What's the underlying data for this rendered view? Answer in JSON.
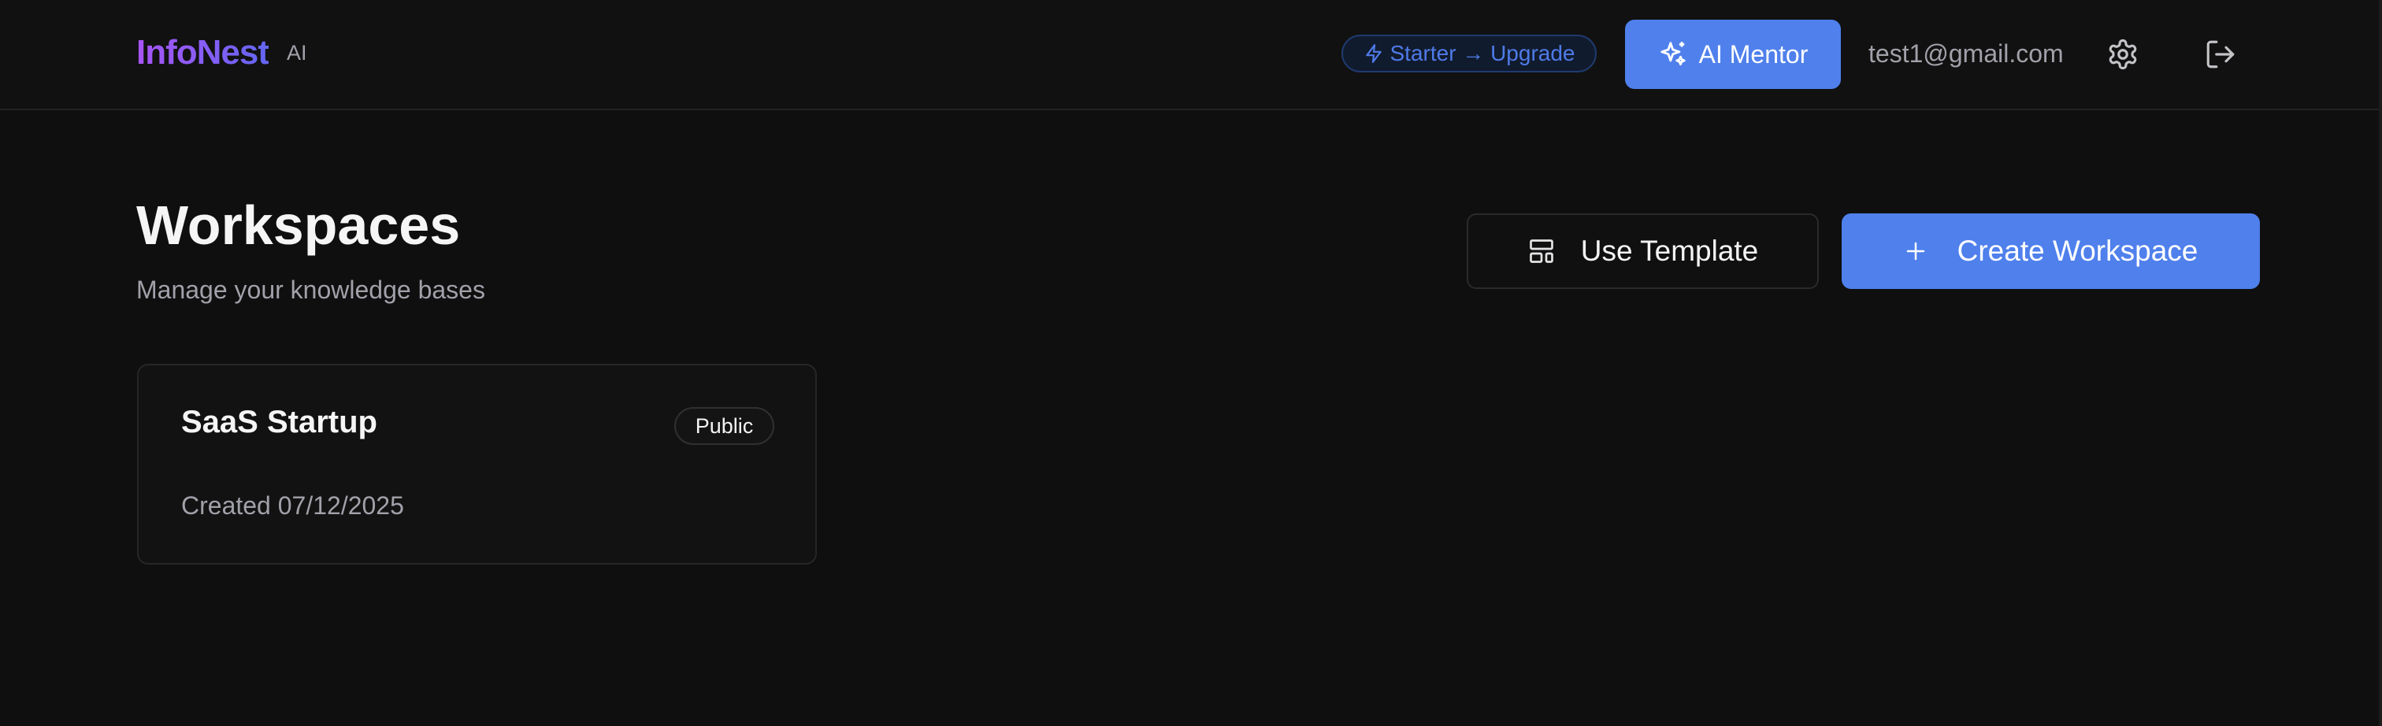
{
  "header": {
    "logo_text": "InfoNest",
    "logo_suffix": "AI",
    "plan_label": "Starter → Upgrade",
    "mentor_label": "AI Mentor",
    "user_email": "test1@gmail.com",
    "icons": {
      "plan": "bolt-icon",
      "mentor": "sparkles-icon",
      "settings": "gear-icon",
      "logout": "logout-icon"
    }
  },
  "main": {
    "title": "Workspaces",
    "subtitle": "Manage your knowledge bases",
    "template_button": "Use Template",
    "create_button": "Create Workspace",
    "icons": {
      "template": "layout-template-icon",
      "create": "plus-icon"
    }
  },
  "workspaces": [
    {
      "name": "SaaS Startup",
      "visibility": "Public",
      "created": "Created 07/12/2025"
    }
  ],
  "colors": {
    "background": "#0f0f0f",
    "accent": "#4f80ec",
    "logo_gradient_start": "#a855f7",
    "logo_gradient_end": "#6366f1",
    "muted_text": "#a1a1aa"
  }
}
